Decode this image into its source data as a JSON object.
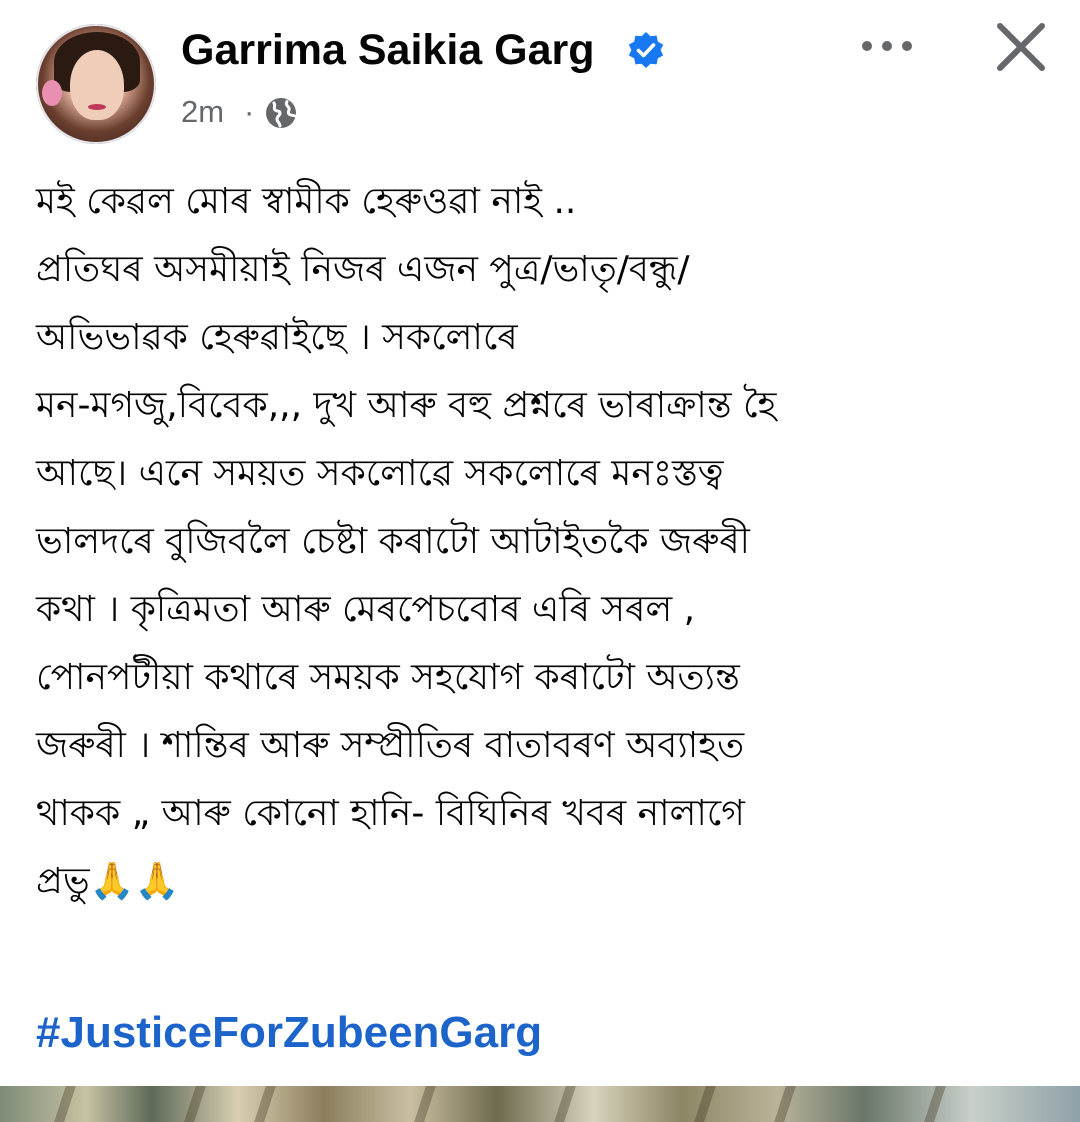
{
  "post": {
    "author_name": "Garrima Saikia Garg",
    "timestamp": "2m",
    "separator": "·",
    "audience_icon": "globe-icon",
    "verified_icon": "verified-badge-icon",
    "more_icon": "more-options-icon",
    "close_icon": "close-icon",
    "text": "মই কেৱল মোৰ স্বামীক হেৰুওৱা নাই ..\n প্ৰতিঘৰ অসমীয়াই নিজৰ এজন পুত্ৰ/ভাতৃ/বন্ধু/\nঅভিভাৱক হেৰুৱাইছে । সকলোৰে\nমন-মগজু,বিবেক,,, দুখ আৰু বহু প্ৰশ্নৰে ভাৰাক্ৰান্ত হৈ\nআছে। এনে সময়ত সকলোৱে সকলোৰে মনঃস্তত্ব\nভালদৰে বুজিবলৈ চেষ্টা কৰাটো আটাইতকৈ জৰুৰী\nকথা । কৃত্ৰিমতা আৰু মেৰপেচবোৰ এৰি সৰল ,\nপোনপটীয়া কথাৰে সময়ক সহযোগ কৰাটো অত্যন্ত\nজৰুৰী । শান্তিৰ আৰু সম্প্ৰীতিৰ বাতাবৰণ অব্যাহত\nথাকক „ আৰু কোনো হানি- বিঘিনিৰ খবৰ নালাগে\nপ্ৰভু🙏🙏",
    "hashtag": "#JusticeForZubeenGarg"
  },
  "colors": {
    "name": "#050505",
    "meta": "#65676b",
    "verified": "#1877f2",
    "hashtag": "#1c64c9",
    "icon": "#65676b"
  }
}
